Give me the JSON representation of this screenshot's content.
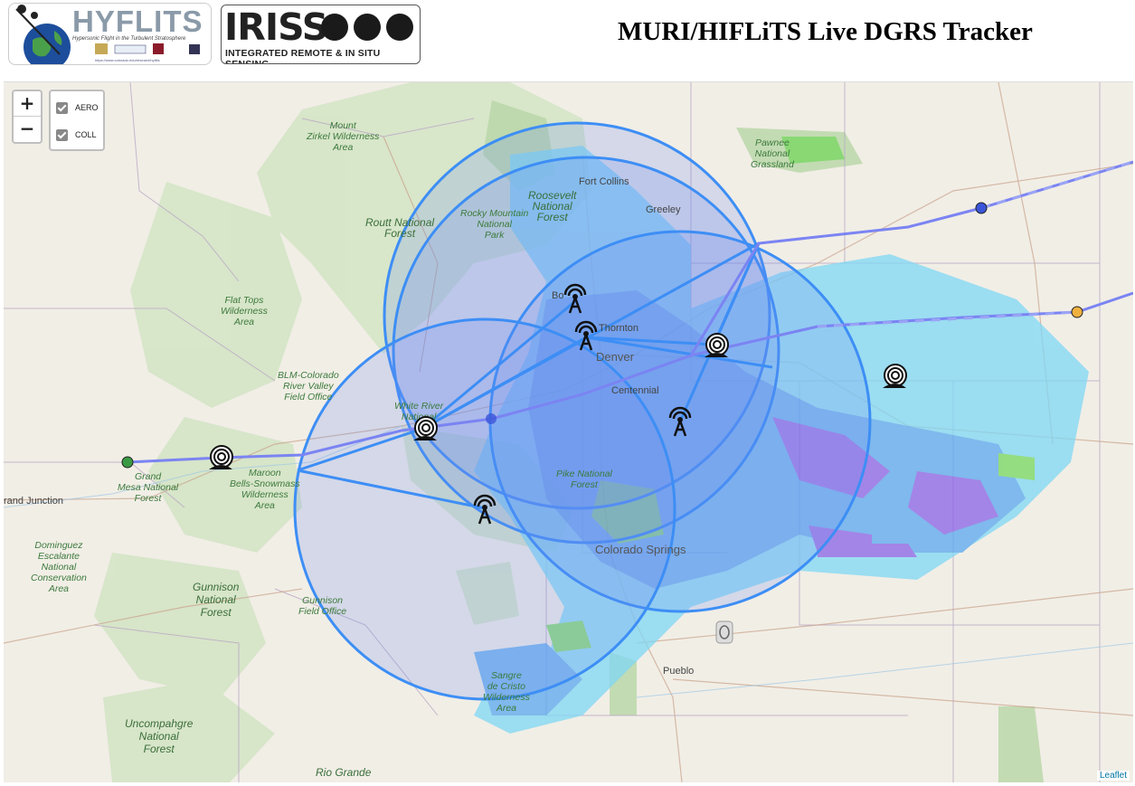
{
  "header": {
    "title": "MURI/HIFLiTS Live DGRS Tracker",
    "hyflits_logo": {
      "word": "HYFLITS",
      "tagline": "Hypersonic Flight in the Turbulent Stratosphere",
      "url": "https://www.colorado.edu/researchhyflits"
    },
    "iriss_logo": {
      "word": "IRISS",
      "subtitle": "INTEGRATED REMOTE & IN SITU SENSING"
    }
  },
  "map": {
    "zoom_in": "+",
    "zoom_out": "−",
    "layers": [
      {
        "label": "AERO",
        "checked": true
      },
      {
        "label": "COLL",
        "checked": true
      }
    ],
    "attribution": "Leaflet",
    "labels": {
      "mount_zirkel": [
        "Mount",
        "Zirkel Wilderness",
        "Area"
      ],
      "routt": [
        "Routt National",
        "Forest"
      ],
      "rmnp": [
        "Rocky Mountain",
        "National",
        "Park"
      ],
      "roosevelt": [
        "Roosevelt",
        "National",
        "Forest"
      ],
      "pawnee": [
        "Pawnee",
        "National",
        "Grassland"
      ],
      "flat_tops": [
        "Flat Tops",
        "Wilderness",
        "Area"
      ],
      "blm": [
        "BLM-Colorado",
        "River Valley",
        "Field Office"
      ],
      "white_river": [
        "White River",
        "National"
      ],
      "maroon": [
        "Maroon",
        "Bells-Snowmass",
        "Wilderness",
        "Area"
      ],
      "grand_mesa": [
        "Grand",
        "Mesa National",
        "Forest"
      ],
      "dominguez": [
        "Dominguez",
        "Escalante",
        "National",
        "Conservation",
        "Area"
      ],
      "gunnison_nf": [
        "Gunnison",
        "National",
        "Forest"
      ],
      "gunnison_fo": [
        "Gunnison",
        "Field Office"
      ],
      "pike": [
        "Pike National",
        "Forest"
      ],
      "sangre": [
        "Sangre",
        "de Cristo",
        "Wilderness",
        "Area"
      ],
      "uncompahgre": [
        "Uncompahgre",
        "National",
        "Forest"
      ],
      "rio_grande": [
        "Rio Grande"
      ]
    },
    "cities": {
      "fort_collins": "Fort Collins",
      "greeley": "Greeley",
      "boulder": "Bo",
      "thornton": "Thornton",
      "denver": "Denver",
      "centennial": "Centennial",
      "colorado_springs": "Colorado Springs",
      "pueblo": "Pueblo",
      "grand_junction": "rand Junction"
    },
    "colors": {
      "track": "#6f7cf0",
      "coverage_fill": "#6f8ff2",
      "coverage_stroke": "#3d8ef5",
      "radar_light": "#7fd8f5",
      "radar_mid": "#5aa8f0",
      "radar_heavy": "#8a62e8",
      "radar_green": "#76d860",
      "marker_green": "#3a9a44",
      "marker_blue": "#3a55d8",
      "marker_orange": "#f0b040"
    }
  }
}
